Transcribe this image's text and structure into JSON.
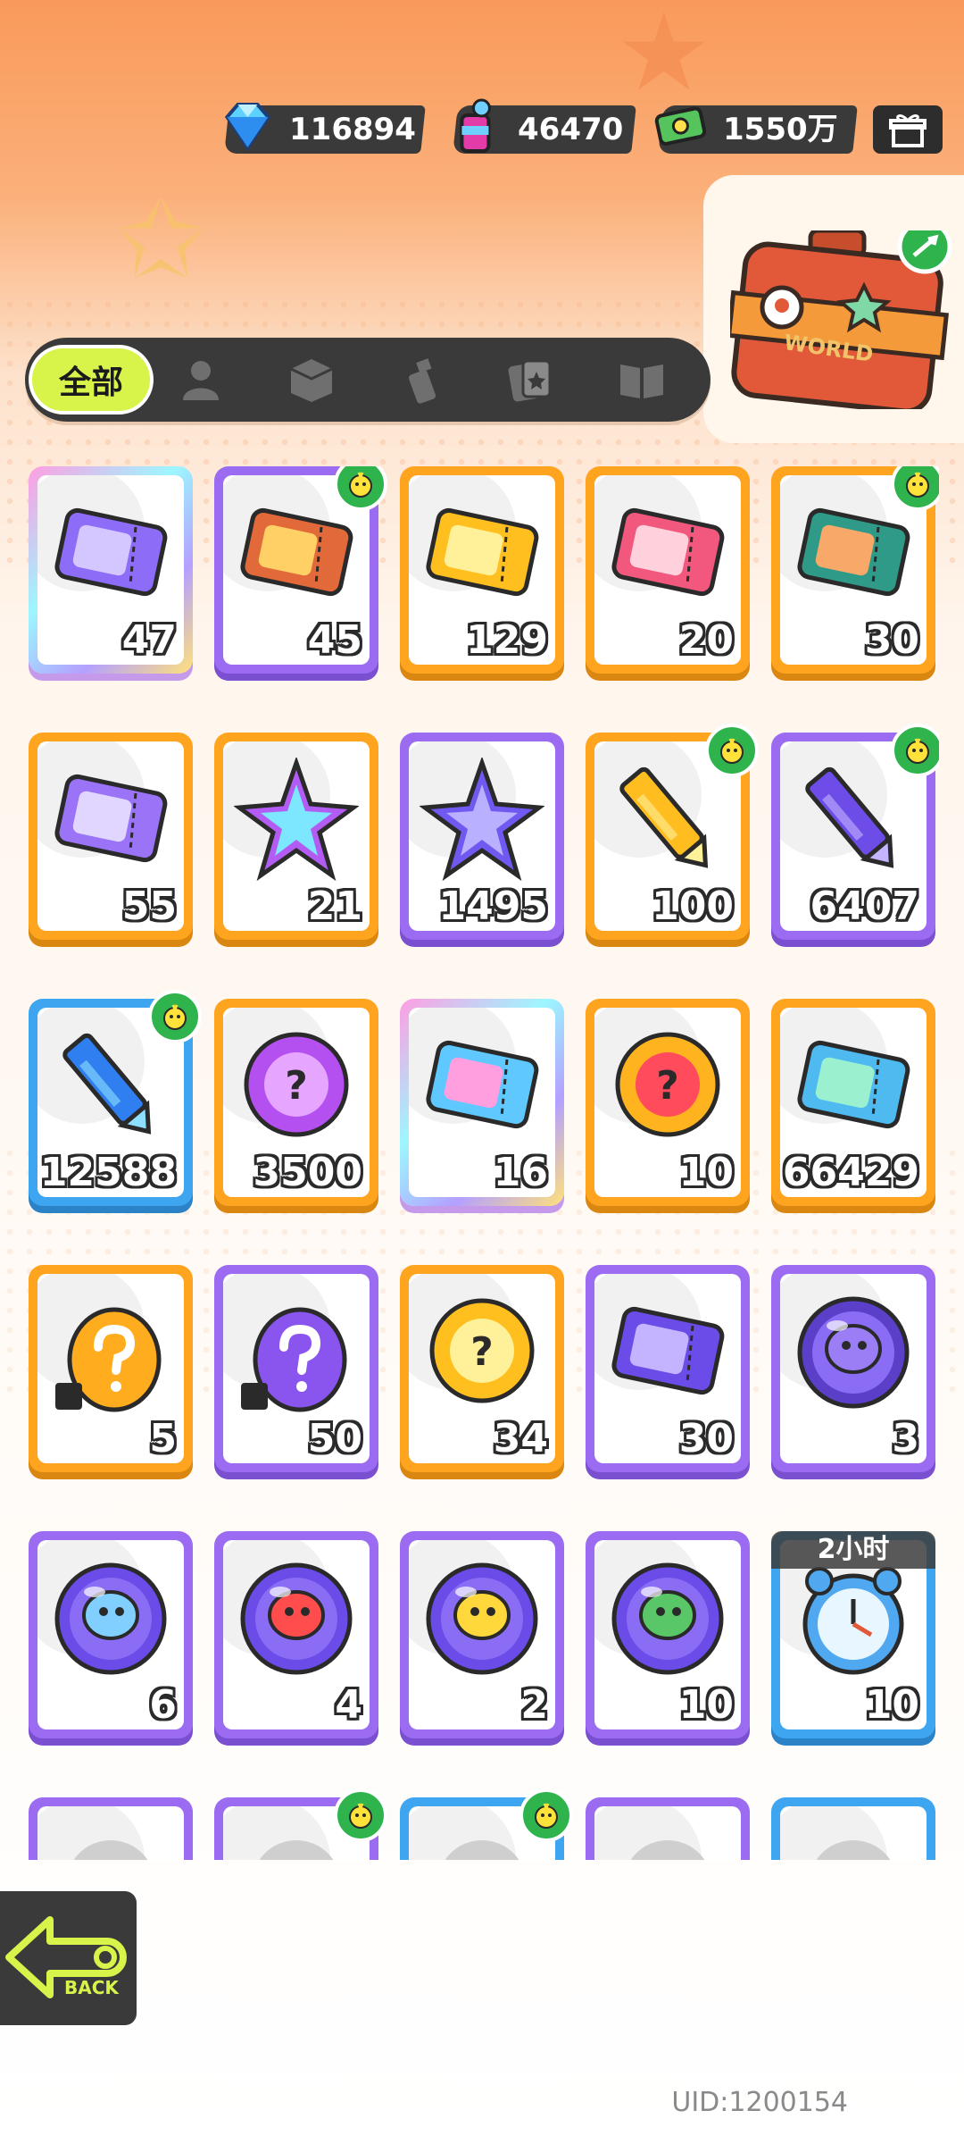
{
  "currency": {
    "diamonds": "116894",
    "paint": "46470",
    "cash": "1550万"
  },
  "world_button": {
    "label": "WORLD"
  },
  "tabs": {
    "all_label": "全部",
    "icons": [
      "person-icon",
      "box-icon",
      "spray-icon",
      "card-icon",
      "book-icon"
    ]
  },
  "items": [
    {
      "qty": "47",
      "frame": "rainbow",
      "icon": "purple-ticket-icon",
      "badge": false
    },
    {
      "qty": "45",
      "frame": "purple",
      "icon": "lion-ticket-icon",
      "badge": true
    },
    {
      "qty": "129",
      "frame": "orange",
      "icon": "gold-ticket-icon",
      "badge": false
    },
    {
      "qty": "20",
      "frame": "orange",
      "icon": "character-ticket-icon",
      "badge": false
    },
    {
      "qty": "30",
      "frame": "orange",
      "icon": "food-ticket-icon",
      "badge": true
    },
    {
      "qty": "55",
      "frame": "orange",
      "icon": "violet-ticket-icon",
      "badge": false
    },
    {
      "qty": "21",
      "frame": "orange",
      "icon": "rainbow-star-icon",
      "badge": false
    },
    {
      "qty": "1495",
      "frame": "purple",
      "icon": "purple-star-icon",
      "badge": false
    },
    {
      "qty": "100",
      "frame": "orange",
      "icon": "gold-crayon-icon",
      "badge": true
    },
    {
      "qty": "6407",
      "frame": "purple",
      "icon": "purple-crayon-icon",
      "badge": true
    },
    {
      "qty": "12588",
      "frame": "blue",
      "icon": "blue-crayon-icon",
      "badge": true
    },
    {
      "qty": "3500",
      "frame": "orange",
      "icon": "cool-badge-icon",
      "badge": false
    },
    {
      "qty": "16",
      "frame": "rainbow",
      "icon": "lottery-ticket-icon",
      "badge": false
    },
    {
      "qty": "10",
      "frame": "orange",
      "icon": "explosion-badge-icon",
      "badge": false
    },
    {
      "qty": "66429",
      "frame": "orange",
      "icon": "season-ticket-icon",
      "badge": false
    },
    {
      "qty": "5",
      "frame": "orange",
      "icon": "gold-mystery-egg-icon",
      "badge": false
    },
    {
      "qty": "50",
      "frame": "purple",
      "icon": "purple-mystery-egg-icon",
      "badge": false
    },
    {
      "qty": "34",
      "frame": "orange",
      "icon": "mystery-coin-icon",
      "badge": false
    },
    {
      "qty": "30",
      "frame": "purple",
      "icon": "mystery-travel-card-icon",
      "badge": false
    },
    {
      "qty": "3",
      "frame": "purple",
      "icon": "monster-orb-icon",
      "badge": false
    },
    {
      "qty": "6",
      "frame": "purple",
      "icon": "fish-orb-icon",
      "badge": false
    },
    {
      "qty": "4",
      "frame": "purple",
      "icon": "piranha-orb-icon",
      "badge": false
    },
    {
      "qty": "2",
      "frame": "purple",
      "icon": "jelly-orb-icon",
      "badge": false
    },
    {
      "qty": "10",
      "frame": "purple",
      "icon": "sprout-orb-icon",
      "badge": false
    },
    {
      "qty": "10",
      "frame": "blue",
      "icon": "alarm-clock-icon",
      "badge": false,
      "timer": "2小时"
    },
    {
      "qty": "",
      "frame": "purple",
      "icon": "partial-item-icon",
      "badge": false
    },
    {
      "qty": "",
      "frame": "purple",
      "icon": "partial-item-icon",
      "badge": true
    },
    {
      "qty": "",
      "frame": "blue",
      "icon": "partial-item-icon",
      "badge": true
    },
    {
      "qty": "",
      "frame": "purple",
      "icon": "partial-item-icon",
      "badge": false
    },
    {
      "qty": "",
      "frame": "blue",
      "icon": "partial-item-icon",
      "badge": false
    }
  ],
  "back_button": {
    "label": "BACK"
  },
  "uid": "UID:1200154"
}
